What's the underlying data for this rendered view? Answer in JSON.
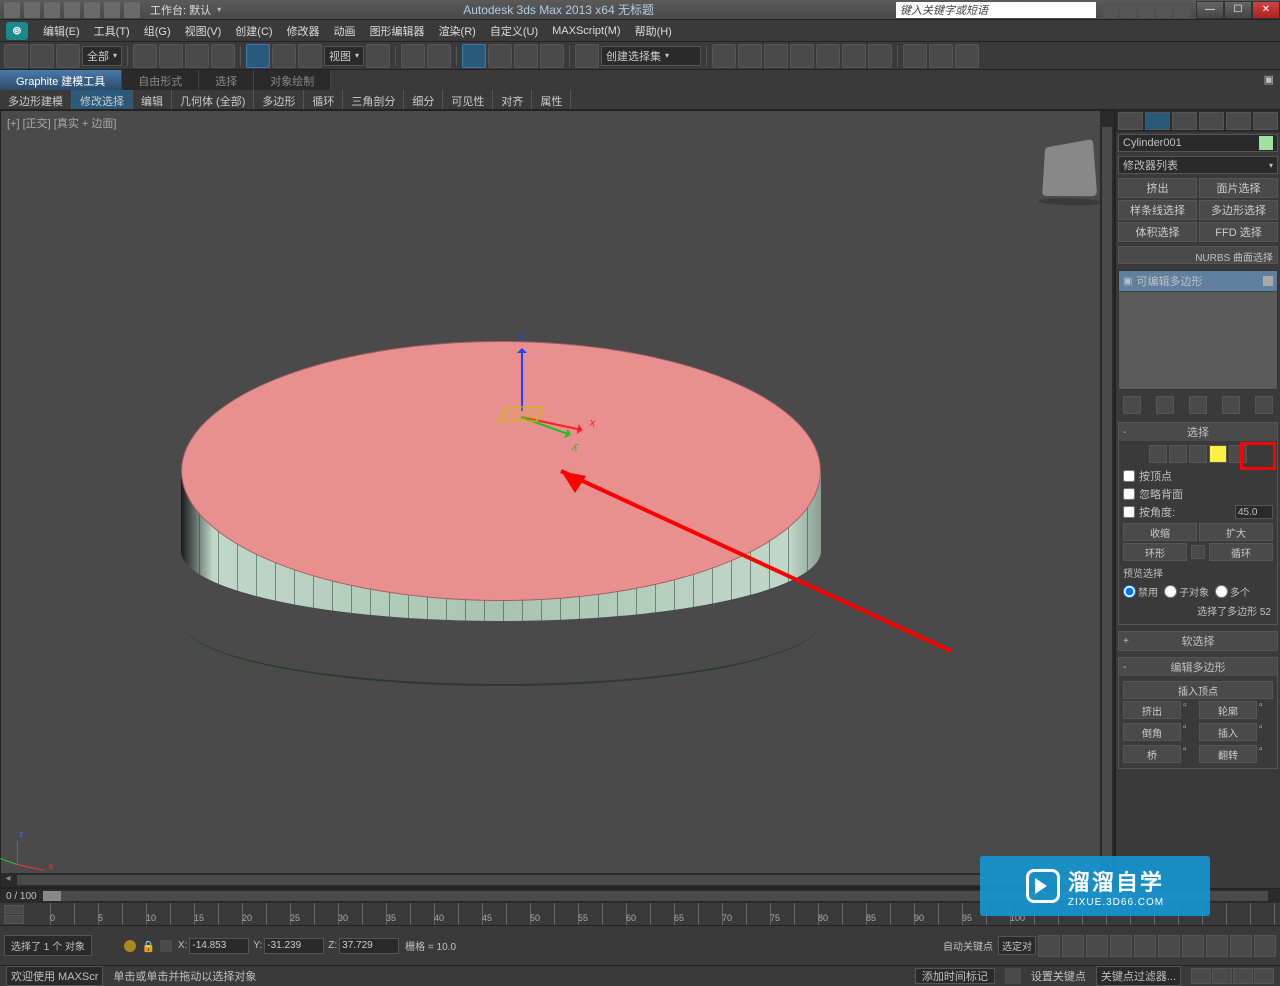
{
  "titlebar": {
    "workspace": "工作台: 默认",
    "app_title": "Autodesk 3ds Max  2013 x64     无标题",
    "search_placeholder": "键入关键字或短语"
  },
  "menu": {
    "edit": "编辑(E)",
    "tools": "工具(T)",
    "group": "组(G)",
    "views": "视图(V)",
    "create": "创建(C)",
    "modifiers": "修改器",
    "anim": "动画",
    "graph": "图形编辑器",
    "render": "渲染(R)",
    "custom": "自定义(U)",
    "maxscript": "MAXScript(M)",
    "help": "帮助(H)"
  },
  "toolbar": {
    "all": "全部",
    "view": "视图",
    "selset": "创建选择集"
  },
  "ribbon": {
    "tab_graphite": "Graphite 建模工具",
    "tab_freeform": "自由形式",
    "tab_select": "选择",
    "tab_paint": "对象绘制",
    "poly_model": "多边形建模",
    "mod_select": "修改选择",
    "edit": "编辑",
    "geom_all": "几何体 (全部)",
    "polygon": "多边形",
    "loop": "循环",
    "tri": "三角剖分",
    "subdiv": "细分",
    "vis": "可见性",
    "align": "对齐",
    "prop": "属性"
  },
  "viewport": {
    "label": "[+] [正交] [真实 + 边面]"
  },
  "panel": {
    "object_name": "Cylinder001",
    "modifier_list": "修改器列表",
    "btn_extrude": "挤出",
    "btn_patch": "面片选择",
    "btn_spline": "样条线选择",
    "btn_polysel": "多边形选择",
    "btn_volsel": "体积选择",
    "btn_ffd": "FFD 选择",
    "nurbs": "NURBS 曲面选择",
    "editable_poly": "可编辑多边形",
    "rollout_select": "选择",
    "chk_byvertex": "按顶点",
    "chk_ignore_back": "忽略背面",
    "chk_byangle": "按角度:",
    "angle_val": "45.0",
    "btn_shrink": "收缩",
    "btn_grow": "扩大",
    "btn_ring": "环形",
    "btn_loop": "循环",
    "preview_sel": "预览选择",
    "rad_disable": "禁用",
    "rad_subobj": "子对象",
    "rad_multi": "多个",
    "sel_status": "选择了多边形 52",
    "rollout_soft": "软选择",
    "rollout_editpoly": "编辑多边形",
    "btn_insertv": "插入顶点",
    "btn_extrude2": "挤出",
    "btn_outline": "轮廓",
    "btn_bevel": "倒角",
    "btn_insert": "插入",
    "btn_bridge": "桥",
    "btn_flip": "翻转"
  },
  "timeline": {
    "range": "0 / 100",
    "ticks": [
      "0",
      "5",
      "10",
      "15",
      "20",
      "25",
      "30",
      "35",
      "40",
      "45",
      "50",
      "55",
      "60",
      "65",
      "70",
      "75",
      "80",
      "85",
      "90",
      "95",
      "100"
    ]
  },
  "status": {
    "welcome": "欢迎使用  MAXScr",
    "sel_count": "选择了 1 个 对象",
    "prompt": "单击或单击并拖动以选择对象",
    "x": "-14.853",
    "y": "-31.239",
    "z": "37.729",
    "grid": "栅格 = 10.0",
    "add_time": "添加时间标记",
    "autokey": "自动关键点",
    "selset": "选定对",
    "setkey": "设置关键点",
    "keyfilter": "关键点过滤器..."
  },
  "watermark": {
    "cn": "溜溜自学",
    "en": "ZIXUE.3D66.COM"
  }
}
